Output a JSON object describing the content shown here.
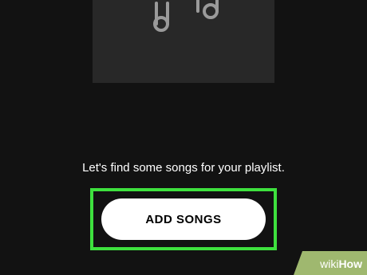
{
  "artwork": {
    "icon": "music-notes-icon"
  },
  "prompt": "Let's find some songs for your playlist.",
  "add_songs_button": "ADD SONGS",
  "watermark": {
    "wiki": "wiki",
    "how": "How"
  },
  "colors": {
    "background": "#121212",
    "artwork_bg": "#282828",
    "note_stroke": "#9a9a9a",
    "button_bg": "#ffffff",
    "highlight": "#3ee13e"
  }
}
